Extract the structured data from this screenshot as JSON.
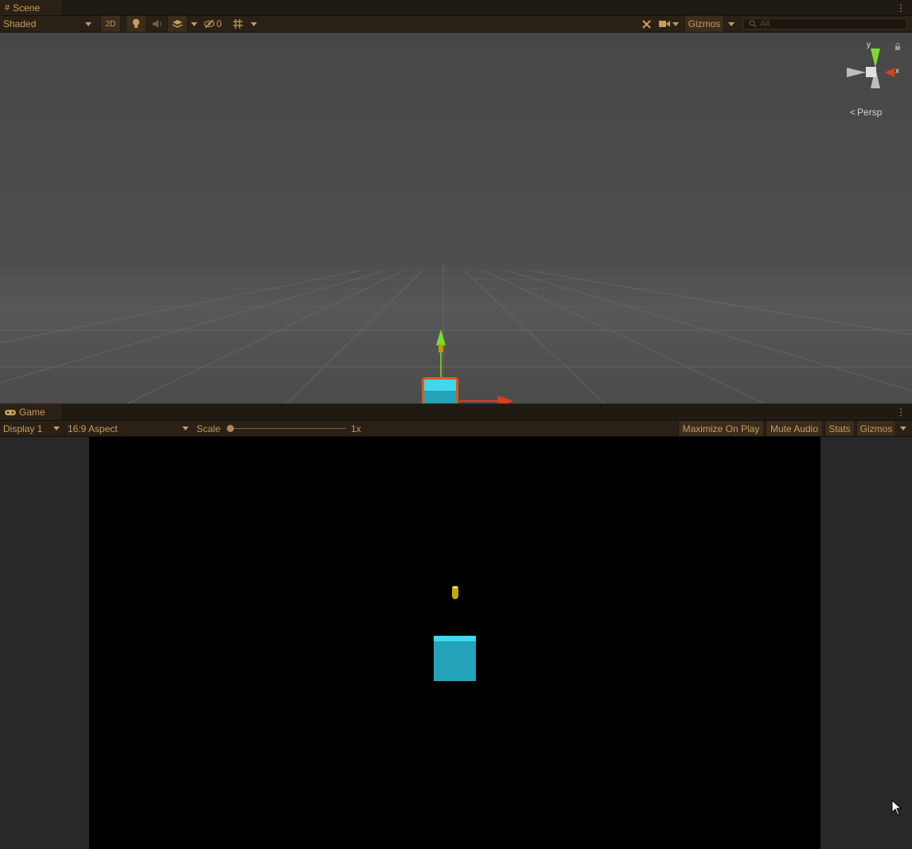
{
  "scene": {
    "tab_label": "Scene",
    "tab_icon": "hash-grid-icon",
    "shading_mode": "Shaded",
    "btn_2d": "2D",
    "hidden_count": "0",
    "gizmos_label": "Gizmos",
    "search_placeholder": "All",
    "persp_label": "Persp",
    "gizmo_axis_y": "y",
    "gizmo_axis_x": "x"
  },
  "game": {
    "tab_label": "Game",
    "tab_icon": "gamepad-icon",
    "display": "Display 1",
    "aspect": "16:9 Aspect",
    "scale_label": "Scale",
    "scale_value": "1x",
    "scale_fraction": 0.0,
    "maximize_label": "Maximize On Play",
    "mute_label": "Mute Audio",
    "stats_label": "Stats",
    "gizmos_label": "Gizmos"
  },
  "colors": {
    "accent_text": "#c79a5e",
    "cube_top": "#3fd8f0",
    "cube_face": "#23a2b8",
    "gizmo_y": "#7cdc2e",
    "gizmo_x": "#d8401c",
    "coin": "#c8a800"
  }
}
